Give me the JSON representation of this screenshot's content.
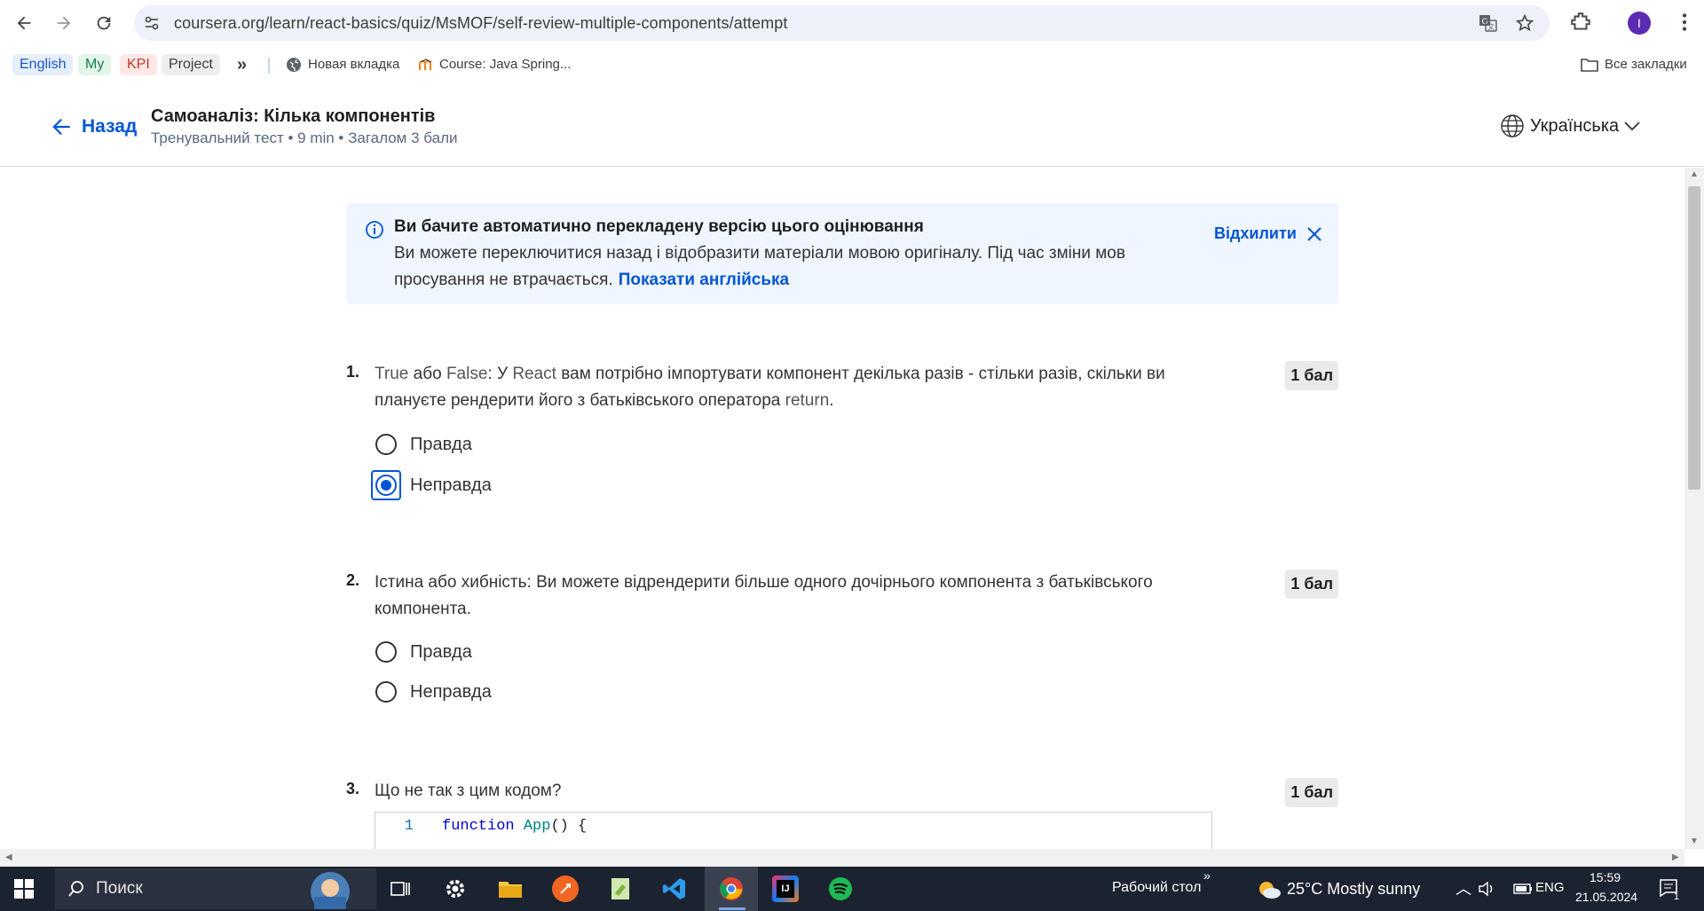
{
  "browser": {
    "url": "coursera.org/learn/react-basics/quiz/MsMOF/self-review-multiple-components/attempt",
    "profile_initial": "I",
    "bookmarks": {
      "chips": [
        {
          "label": "English",
          "color": "#1a56c4",
          "bg": "#e6eefc"
        },
        {
          "label": "My",
          "color": "#1a7f4a",
          "bg": "#e3f4ea"
        },
        {
          "label": "KPI",
          "color": "#c0392b",
          "bg": "#fde8e6"
        },
        {
          "label": "Project",
          "color": "#3c3c3c",
          "bg": "#eeeeee"
        }
      ],
      "more": "»",
      "items": [
        {
          "label": "Новая вкладка",
          "icon": "globe-icon"
        },
        {
          "label": "Course: Java Spring...",
          "icon": "moodle-icon"
        }
      ],
      "all_bookmarks": "Все закладки"
    }
  },
  "header": {
    "back_label": "Назад",
    "title": "Самоаналіз: Кілька компонентів",
    "subtitle": "Тренувальний тест • 9 min • Загалом 3 бали",
    "language": "Українська"
  },
  "banner": {
    "title": "Ви бачите автоматично перекладену версію цього оцінювання",
    "body": "Ви можете переключитися назад і відобразити матеріали мовою оригіналу. Під час зміни мов просування не втрачається.",
    "link": "Показати англійська",
    "dismiss": "Відхилити"
  },
  "questions": [
    {
      "number": "1.",
      "text_parts": [
        "True",
        " або ",
        "False",
        ": У ",
        "React",
        " вам потрібно імпортувати компонент декілька разів - стільки разів, скільки ви плануєте рендерити його з батьківського оператора ",
        "return",
        "."
      ],
      "points": "1 бал",
      "options": [
        {
          "label": "Правда",
          "checked": false
        },
        {
          "label": "Неправда",
          "checked": true
        }
      ]
    },
    {
      "number": "2.",
      "text": "Істина або хибність: Ви можете відрендерити більше одного дочірнього компонента з батьківського компонента.",
      "points": "1 бал",
      "options": [
        {
          "label": "Правда",
          "checked": false
        },
        {
          "label": "Неправда",
          "checked": false
        }
      ]
    },
    {
      "number": "3.",
      "text": "Що не так з цим кодом?",
      "points": "1 бал",
      "code": {
        "line_number": "1",
        "keyword": "function",
        "name": "App",
        "rest": "() {"
      }
    }
  ],
  "taskbar": {
    "search_placeholder": "Поиск",
    "desktop_label": "Рабочий стол",
    "desktop_chevron": "»",
    "weather": "25°C  Mostly sunny",
    "lang": "ENG",
    "time": "15:59",
    "date": "21.05.2024",
    "notifications": "1"
  },
  "colors": {
    "accent": "#0056d2",
    "banner_bg": "#f0f6ff",
    "taskbar_bg": "#1c2330"
  }
}
